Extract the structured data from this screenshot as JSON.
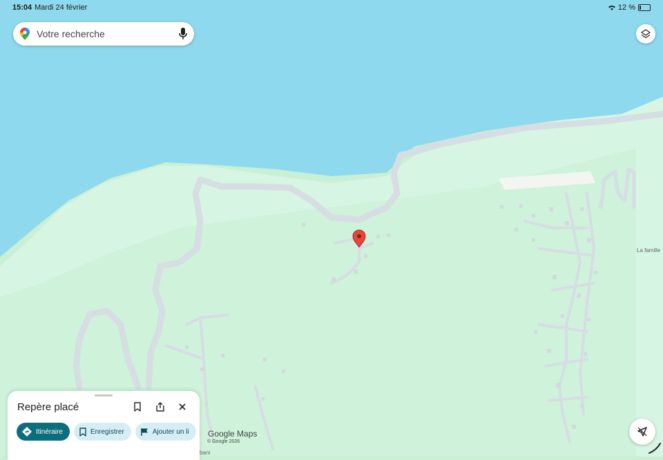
{
  "status_bar": {
    "time": "15:04",
    "date": "Mardi 24 février",
    "battery": "12 %"
  },
  "search": {
    "placeholder": "Votre recherche"
  },
  "map_labels": {
    "place_right": "La famille",
    "place_bottom": "bani"
  },
  "sheet": {
    "title": "Repère placé",
    "chips": {
      "directions": "Itinéraire",
      "save": "Enregistrer",
      "add_label": "Ajouter un li"
    }
  },
  "watermark": {
    "google": "Google",
    "maps": "Maps",
    "copyright": "© Google 2026"
  },
  "colors": {
    "water": "#8ed9ee",
    "land_light": "#d7f5e3",
    "land": "#c9efd4",
    "road": "#d6dde3",
    "accent": "#0b6e7c",
    "pin": "#e8453c"
  },
  "icons": [
    "map-pin-icon",
    "microphone-icon",
    "layers-icon",
    "bookmark-icon",
    "share-icon",
    "close-icon",
    "directions-icon",
    "flag-icon",
    "location-arrow-icon"
  ]
}
